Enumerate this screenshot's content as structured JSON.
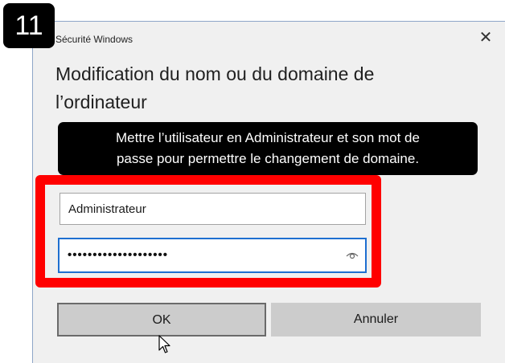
{
  "step_number": "11",
  "dialog": {
    "title": "Sécurité Windows",
    "heading": "Modification du nom ou du domaine de l’ordinateur"
  },
  "tooltip": {
    "line1": "Mettre l’utilisateur en Administrateur et son mot de",
    "line2": "passe pour permettre le changement de domaine."
  },
  "username": {
    "value": "Administrateur"
  },
  "password": {
    "value": "••••••••••••••••••••"
  },
  "buttons": {
    "ok_label": "OK",
    "cancel_label": "Annuler"
  },
  "icons": {
    "close": "close-icon",
    "reveal": "eye-icon",
    "cursor": "mouse-pointer-icon"
  },
  "colors": {
    "highlight": "#ff0000",
    "focus_border": "#1e6fd0",
    "badge_bg": "#000000"
  }
}
